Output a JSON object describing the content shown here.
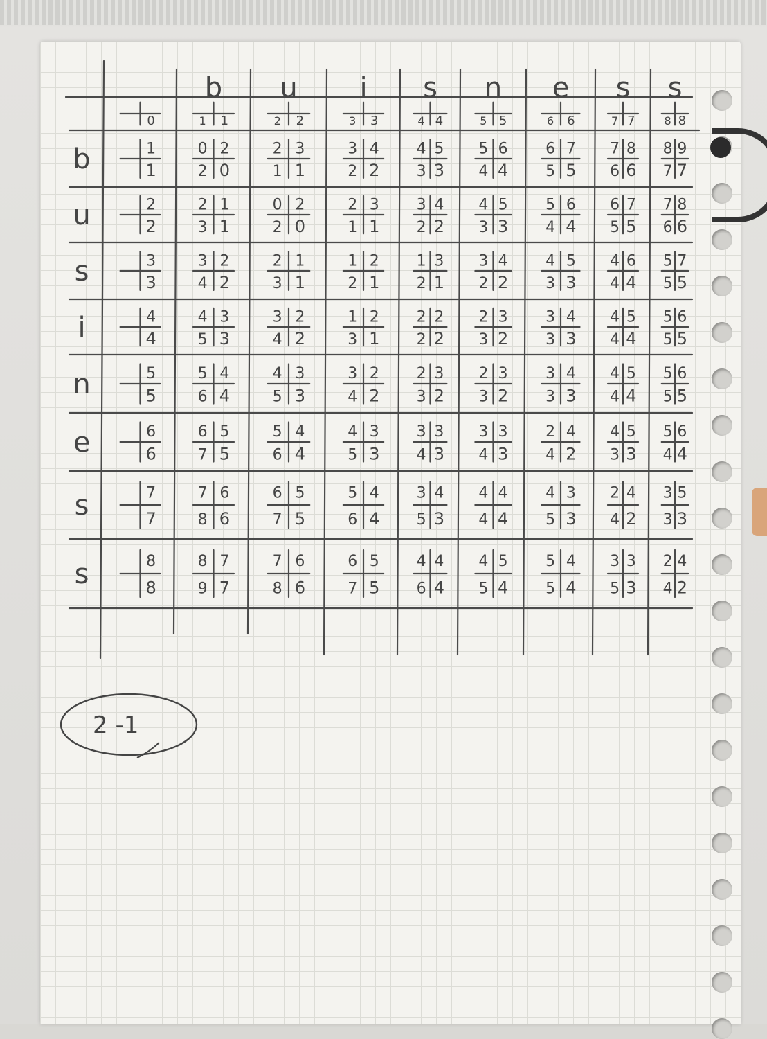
{
  "word_top": [
    "b",
    "u",
    "i",
    "s",
    "n",
    "e",
    "s",
    "s"
  ],
  "word_left": [
    "b",
    "u",
    "s",
    "i",
    "n",
    "e",
    "s",
    "s"
  ],
  "header_row": [
    {
      "d": "",
      "l": "",
      "c": "0"
    },
    {
      "d": "",
      "l": "1",
      "c": "1"
    },
    {
      "d": "",
      "l": "2",
      "c": "2"
    },
    {
      "d": "",
      "l": "3",
      "c": "3"
    },
    {
      "d": "",
      "l": "4",
      "c": "4"
    },
    {
      "d": "",
      "l": "5",
      "c": "5"
    },
    {
      "d": "",
      "l": "6",
      "c": "6"
    },
    {
      "d": "",
      "l": "7",
      "c": "7"
    },
    {
      "d": "",
      "l": "8",
      "c": "8"
    }
  ],
  "rows": [
    [
      {
        "d": "",
        "t": "1",
        "l": "",
        "c": "1"
      },
      {
        "d": "0",
        "t": "2",
        "l": "2",
        "c": "0"
      },
      {
        "d": "2",
        "t": "3",
        "l": "1",
        "c": "1"
      },
      {
        "d": "3",
        "t": "4",
        "l": "2",
        "c": "2"
      },
      {
        "d": "4",
        "t": "5",
        "l": "3",
        "c": "3"
      },
      {
        "d": "5",
        "t": "6",
        "l": "4",
        "c": "4"
      },
      {
        "d": "6",
        "t": "7",
        "l": "5",
        "c": "5"
      },
      {
        "d": "7",
        "t": "8",
        "l": "6",
        "c": "6"
      },
      {
        "d": "8",
        "t": "9",
        "l": "7",
        "c": "7"
      }
    ],
    [
      {
        "d": "",
        "t": "2",
        "l": "",
        "c": "2"
      },
      {
        "d": "2",
        "t": "1",
        "l": "3",
        "c": "1"
      },
      {
        "d": "0",
        "t": "2",
        "l": "2",
        "c": "0"
      },
      {
        "d": "2",
        "t": "3",
        "l": "1",
        "c": "1"
      },
      {
        "d": "3",
        "t": "4",
        "l": "2",
        "c": "2"
      },
      {
        "d": "4",
        "t": "5",
        "l": "3",
        "c": "3"
      },
      {
        "d": "5",
        "t": "6",
        "l": "4",
        "c": "4"
      },
      {
        "d": "6",
        "t": "7",
        "l": "5",
        "c": "5"
      },
      {
        "d": "7",
        "t": "8",
        "l": "6",
        "c": "6"
      }
    ],
    [
      {
        "d": "",
        "t": "3",
        "l": "",
        "c": "3"
      },
      {
        "d": "3",
        "t": "2",
        "l": "4",
        "c": "2"
      },
      {
        "d": "2",
        "t": "1",
        "l": "3",
        "c": "1"
      },
      {
        "d": "1",
        "t": "2",
        "l": "2",
        "c": "1"
      },
      {
        "d": "1",
        "t": "3",
        "l": "2",
        "c": "1"
      },
      {
        "d": "3",
        "t": "4",
        "l": "2",
        "c": "2"
      },
      {
        "d": "4",
        "t": "5",
        "l": "3",
        "c": "3"
      },
      {
        "d": "4",
        "t": "6",
        "l": "4",
        "c": "4"
      },
      {
        "d": "5",
        "t": "7",
        "l": "5",
        "c": "5"
      }
    ],
    [
      {
        "d": "",
        "t": "4",
        "l": "",
        "c": "4"
      },
      {
        "d": "4",
        "t": "3",
        "l": "5",
        "c": "3"
      },
      {
        "d": "3",
        "t": "2",
        "l": "4",
        "c": "2"
      },
      {
        "d": "1",
        "t": "2",
        "l": "3",
        "c": "1"
      },
      {
        "d": "2",
        "t": "2",
        "l": "2",
        "c": "2"
      },
      {
        "d": "2",
        "t": "3",
        "l": "3",
        "c": "2"
      },
      {
        "d": "3",
        "t": "4",
        "l": "3",
        "c": "3"
      },
      {
        "d": "4",
        "t": "5",
        "l": "4",
        "c": "4"
      },
      {
        "d": "5",
        "t": "6",
        "l": "5",
        "c": "5"
      }
    ],
    [
      {
        "d": "",
        "t": "5",
        "l": "",
        "c": "5"
      },
      {
        "d": "5",
        "t": "4",
        "l": "6",
        "c": "4"
      },
      {
        "d": "4",
        "t": "3",
        "l": "5",
        "c": "3"
      },
      {
        "d": "3",
        "t": "2",
        "l": "4",
        "c": "2"
      },
      {
        "d": "2",
        "t": "3",
        "l": "3",
        "c": "2"
      },
      {
        "d": "2",
        "t": "3",
        "l": "3",
        "c": "2"
      },
      {
        "d": "3",
        "t": "4",
        "l": "3",
        "c": "3"
      },
      {
        "d": "4",
        "t": "5",
        "l": "4",
        "c": "4"
      },
      {
        "d": "5",
        "t": "6",
        "l": "5",
        "c": "5"
      }
    ],
    [
      {
        "d": "",
        "t": "6",
        "l": "",
        "c": "6"
      },
      {
        "d": "6",
        "t": "5",
        "l": "7",
        "c": "5"
      },
      {
        "d": "5",
        "t": "4",
        "l": "6",
        "c": "4"
      },
      {
        "d": "4",
        "t": "3",
        "l": "5",
        "c": "3"
      },
      {
        "d": "3",
        "t": "3",
        "l": "4",
        "c": "3"
      },
      {
        "d": "3",
        "t": "3",
        "l": "4",
        "c": "3"
      },
      {
        "d": "2",
        "t": "4",
        "l": "4",
        "c": "2"
      },
      {
        "d": "4",
        "t": "5",
        "l": "3",
        "c": "3"
      },
      {
        "d": "5",
        "t": "6",
        "l": "4",
        "c": "4"
      }
    ],
    [
      {
        "d": "",
        "t": "7",
        "l": "",
        "c": "7"
      },
      {
        "d": "7",
        "t": "6",
        "l": "8",
        "c": "6"
      },
      {
        "d": "6",
        "t": "5",
        "l": "7",
        "c": "5"
      },
      {
        "d": "5",
        "t": "4",
        "l": "6",
        "c": "4"
      },
      {
        "d": "3",
        "t": "4",
        "l": "5",
        "c": "3"
      },
      {
        "d": "4",
        "t": "4",
        "l": "4",
        "c": "4"
      },
      {
        "d": "4",
        "t": "3",
        "l": "5",
        "c": "3"
      },
      {
        "d": "2",
        "t": "4",
        "l": "4",
        "c": "2"
      },
      {
        "d": "3",
        "t": "5",
        "l": "3",
        "c": "3"
      }
    ],
    [
      {
        "d": "",
        "t": "8",
        "l": "",
        "c": "8"
      },
      {
        "d": "8",
        "t": "7",
        "l": "9",
        "c": "7"
      },
      {
        "d": "7",
        "t": "6",
        "l": "8",
        "c": "6"
      },
      {
        "d": "6",
        "t": "5",
        "l": "7",
        "c": "5"
      },
      {
        "d": "4",
        "t": "4",
        "l": "6",
        "c": "4"
      },
      {
        "d": "4",
        "t": "5",
        "l": "5",
        "c": "4"
      },
      {
        "d": "5",
        "t": "4",
        "l": "5",
        "c": "4"
      },
      {
        "d": "3",
        "t": "3",
        "l": "5",
        "c": "3"
      },
      {
        "d": "2",
        "t": "4",
        "l": "4",
        "c": "2"
      }
    ]
  ],
  "circled_note": "2 -1",
  "ink_color": "#454545",
  "paper_color": "#f4f3ef"
}
